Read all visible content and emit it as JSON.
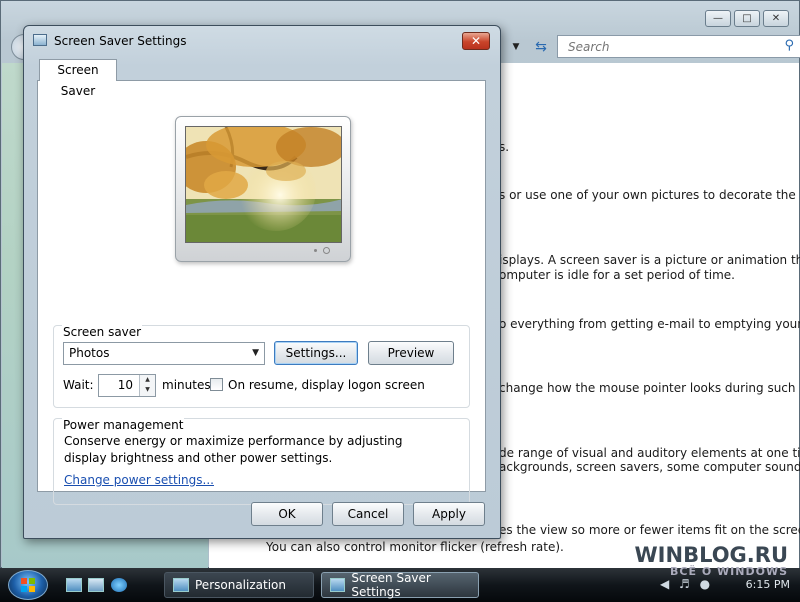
{
  "background_window": {
    "search_placeholder": "Search",
    "content_lines": [
      "s.",
      "s or use one of your own pictures to decorate the",
      "isplays. A screen saver is a picture or animation that",
      "omputer is idle for a set period of time.",
      "o everything from getting e-mail to emptying your",
      "change how the mouse pointer looks during such",
      "de range of visual and auditory elements at one time",
      "ackgrounds, screen savers, some computer sounds,",
      "es the view so more or fewer items fit on the screen.",
      "You can also control monitor flicker (refresh rate)."
    ]
  },
  "dialog": {
    "title": "Screen Saver Settings",
    "tab": "Screen Saver",
    "screen_saver_group": {
      "title": "Screen saver",
      "selected": "Photos",
      "settings_button": "Settings...",
      "preview_button": "Preview",
      "wait_label": "Wait:",
      "wait_value": "10",
      "minutes_label": "minutes",
      "resume_label": "On resume, display logon screen",
      "resume_checked": false
    },
    "power_group": {
      "title": "Power management",
      "description": "Conserve energy or maximize performance by adjusting display brightness and other power settings.",
      "link": "Change power settings..."
    },
    "ok_button": "OK",
    "cancel_button": "Cancel",
    "apply_button": "Apply"
  },
  "taskbar": {
    "tasks": [
      "Personalization",
      "Screen Saver Settings"
    ],
    "clock": "6:15 PM",
    "watermark_main": "WINBLOG.RU",
    "watermark_sub": "ВСЁ О WINDOWS"
  },
  "colors": {
    "link": "#1a4fb0",
    "close_button": "#c9442a",
    "title_bar": "#c2d0db"
  }
}
